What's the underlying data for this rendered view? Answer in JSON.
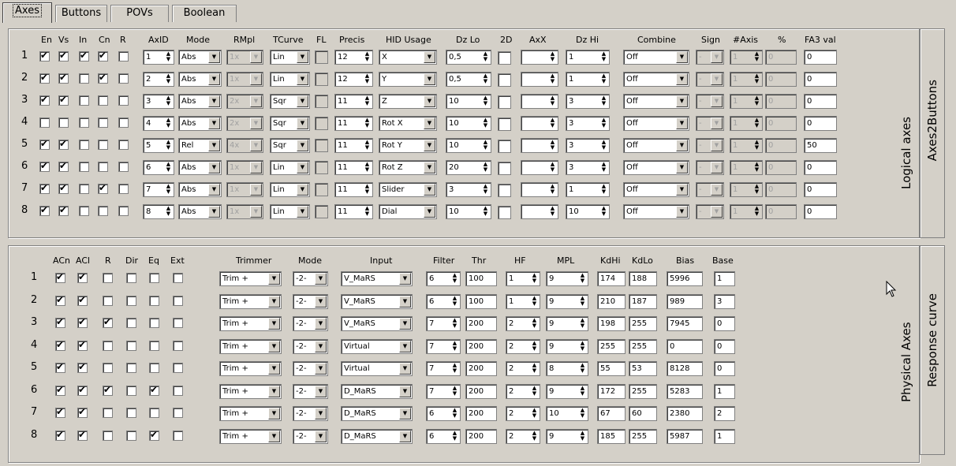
{
  "tabs": [
    {
      "label": "Axes",
      "active": true
    },
    {
      "label": "Buttons",
      "active": false
    },
    {
      "label": "POVs",
      "active": false
    },
    {
      "label": "Boolean",
      "active": false
    }
  ],
  "logical": {
    "panel_label": "Logical axes",
    "side_tab": "Axes2Buttons",
    "headers": {
      "en": "En",
      "vs": "Vs",
      "in": "In",
      "cn": "Cn",
      "r": "R",
      "axid": "AxID",
      "mode": "Mode",
      "rmpl": "RMpl",
      "tcurve": "TCurve",
      "fl": "FL",
      "precis": "Precis",
      "hid": "HID Usage",
      "dzlo": "Dz Lo",
      "twod": "2D",
      "axx": "AxX",
      "dzhi": "Dz Hi",
      "combine": "Combine",
      "sign": "Sign",
      "naxis": "#Axis",
      "pct": "%",
      "fa3": "FA3 val"
    },
    "rows": [
      {
        "num": "1",
        "en": true,
        "vs": true,
        "in": true,
        "cn": true,
        "r": false,
        "axid": "1",
        "mode": "Abs",
        "rmpl": "1x",
        "tcurve": "Lin",
        "precis": "12",
        "hid": "X",
        "dzlo": "0,5",
        "axx": "",
        "dzhi": "1",
        "combine": "Off",
        "sign": "-",
        "naxis": "1",
        "pct": "0",
        "fa3": "0"
      },
      {
        "num": "2",
        "en": true,
        "vs": true,
        "in": false,
        "cn": true,
        "r": false,
        "axid": "2",
        "mode": "Abs",
        "rmpl": "1x",
        "tcurve": "Lin",
        "precis": "12",
        "hid": "Y",
        "dzlo": "0,5",
        "axx": "",
        "dzhi": "1",
        "combine": "Off",
        "sign": "-",
        "naxis": "1",
        "pct": "0",
        "fa3": "0"
      },
      {
        "num": "3",
        "en": true,
        "vs": true,
        "in": false,
        "cn": false,
        "r": false,
        "axid": "3",
        "mode": "Abs",
        "rmpl": "2x",
        "tcurve": "Sqr",
        "precis": "11",
        "hid": "Z",
        "dzlo": "10",
        "axx": "",
        "dzhi": "3",
        "combine": "Off",
        "sign": "-",
        "naxis": "1",
        "pct": "0",
        "fa3": "0"
      },
      {
        "num": "4",
        "en": false,
        "vs": false,
        "in": false,
        "cn": false,
        "r": false,
        "axid": "4",
        "mode": "Abs",
        "rmpl": "2x",
        "tcurve": "Sqr",
        "precis": "11",
        "hid": "Rot X",
        "dzlo": "10",
        "axx": "",
        "dzhi": "3",
        "combine": "Off",
        "sign": "-",
        "naxis": "1",
        "pct": "0",
        "fa3": "0"
      },
      {
        "num": "5",
        "en": true,
        "vs": true,
        "in": false,
        "cn": false,
        "r": false,
        "axid": "5",
        "mode": "Rel",
        "rmpl": "4x",
        "tcurve": "Sqr",
        "precis": "11",
        "hid": "Rot Y",
        "dzlo": "10",
        "axx": "",
        "dzhi": "3",
        "combine": "Off",
        "sign": "-",
        "naxis": "1",
        "pct": "0",
        "fa3": "50"
      },
      {
        "num": "6",
        "en": true,
        "vs": true,
        "in": false,
        "cn": false,
        "r": false,
        "axid": "6",
        "mode": "Abs",
        "rmpl": "1x",
        "tcurve": "Lin",
        "precis": "11",
        "hid": "Rot Z",
        "dzlo": "20",
        "axx": "",
        "dzhi": "3",
        "combine": "Off",
        "sign": "-",
        "naxis": "1",
        "pct": "0",
        "fa3": "0"
      },
      {
        "num": "7",
        "en": true,
        "vs": true,
        "in": false,
        "cn": true,
        "r": false,
        "axid": "7",
        "mode": "Abs",
        "rmpl": "1x",
        "tcurve": "Lin",
        "precis": "11",
        "hid": "Slider",
        "dzlo": "3",
        "axx": "",
        "dzhi": "1",
        "combine": "Off",
        "sign": "-",
        "naxis": "1",
        "pct": "0",
        "fa3": "0"
      },
      {
        "num": "8",
        "en": true,
        "vs": true,
        "in": false,
        "cn": false,
        "r": false,
        "axid": "8",
        "mode": "Abs",
        "rmpl": "1x",
        "tcurve": "Lin",
        "precis": "11",
        "hid": "Dial",
        "dzlo": "10",
        "axx": "",
        "dzhi": "10",
        "combine": "Off",
        "sign": "-",
        "naxis": "1",
        "pct": "0",
        "fa3": "0"
      }
    ]
  },
  "physical": {
    "panel_label": "Physical Axes",
    "side_tab": "Response curve",
    "headers": {
      "acn": "ACn",
      "acl": "ACl",
      "r": "R",
      "dir": "Dir",
      "eq": "Eq",
      "ext": "Ext",
      "trimmer": "Trimmer",
      "mode": "Mode",
      "input": "Input",
      "filter": "Filter",
      "thr": "Thr",
      "hf": "HF",
      "mpl": "MPL",
      "kdhi": "KdHi",
      "kdlo": "KdLo",
      "bias": "Bias",
      "base": "Base"
    },
    "rows": [
      {
        "num": "1",
        "acn": true,
        "acl": true,
        "r": false,
        "dir": false,
        "eq": false,
        "ext": false,
        "trimmer": "Trim +",
        "mode": "-2-",
        "input": "V_MaRS",
        "filter": "6",
        "thr": "100",
        "hf": "1",
        "mpl": "9",
        "kdhi": "174",
        "kdlo": "188",
        "bias": "5996",
        "base": "1"
      },
      {
        "num": "2",
        "acn": true,
        "acl": true,
        "r": false,
        "dir": false,
        "eq": false,
        "ext": false,
        "trimmer": "Trim +",
        "mode": "-2-",
        "input": "V_MaRS",
        "filter": "6",
        "thr": "100",
        "hf": "1",
        "mpl": "9",
        "kdhi": "210",
        "kdlo": "187",
        "bias": "989",
        "base": "3"
      },
      {
        "num": "3",
        "acn": true,
        "acl": true,
        "r": true,
        "dir": false,
        "eq": false,
        "ext": false,
        "trimmer": "Trim +",
        "mode": "-2-",
        "input": "V_MaRS",
        "filter": "7",
        "thr": "200",
        "hf": "2",
        "mpl": "9",
        "kdhi": "198",
        "kdlo": "255",
        "bias": "7945",
        "base": "0"
      },
      {
        "num": "4",
        "acn": true,
        "acl": true,
        "r": false,
        "dir": false,
        "eq": false,
        "ext": false,
        "trimmer": "Trim +",
        "mode": "-2-",
        "input": "Virtual",
        "filter": "7",
        "thr": "200",
        "hf": "2",
        "mpl": "9",
        "kdhi": "255",
        "kdlo": "255",
        "bias": "0",
        "base": "0"
      },
      {
        "num": "5",
        "acn": true,
        "acl": true,
        "r": false,
        "dir": false,
        "eq": false,
        "ext": false,
        "trimmer": "Trim +",
        "mode": "-2-",
        "input": "Virtual",
        "filter": "7",
        "thr": "200",
        "hf": "2",
        "mpl": "8",
        "kdhi": "55",
        "kdlo": "53",
        "bias": "8128",
        "base": "0"
      },
      {
        "num": "6",
        "acn": true,
        "acl": true,
        "r": true,
        "dir": false,
        "eq": true,
        "ext": false,
        "trimmer": "Trim +",
        "mode": "-2-",
        "input": "D_MaRS",
        "filter": "7",
        "thr": "200",
        "hf": "2",
        "mpl": "9",
        "kdhi": "172",
        "kdlo": "255",
        "bias": "5283",
        "base": "1"
      },
      {
        "num": "7",
        "acn": true,
        "acl": true,
        "r": false,
        "dir": false,
        "eq": false,
        "ext": false,
        "trimmer": "Trim +",
        "mode": "-2-",
        "input": "D_MaRS",
        "filter": "6",
        "thr": "200",
        "hf": "2",
        "mpl": "10",
        "kdhi": "67",
        "kdlo": "60",
        "bias": "2380",
        "base": "2"
      },
      {
        "num": "8",
        "acn": true,
        "acl": true,
        "r": false,
        "dir": false,
        "eq": true,
        "ext": false,
        "trimmer": "Trim +",
        "mode": "-2-",
        "input": "D_MaRS",
        "filter": "6",
        "thr": "200",
        "hf": "2",
        "mpl": "9",
        "kdhi": "185",
        "kdlo": "255",
        "bias": "5987",
        "base": "1"
      }
    ]
  },
  "icons": {
    "spin": "spin-arrows-icon",
    "dropdown": "dropdown-arrow-icon",
    "cursor": "mouse-cursor-icon"
  }
}
